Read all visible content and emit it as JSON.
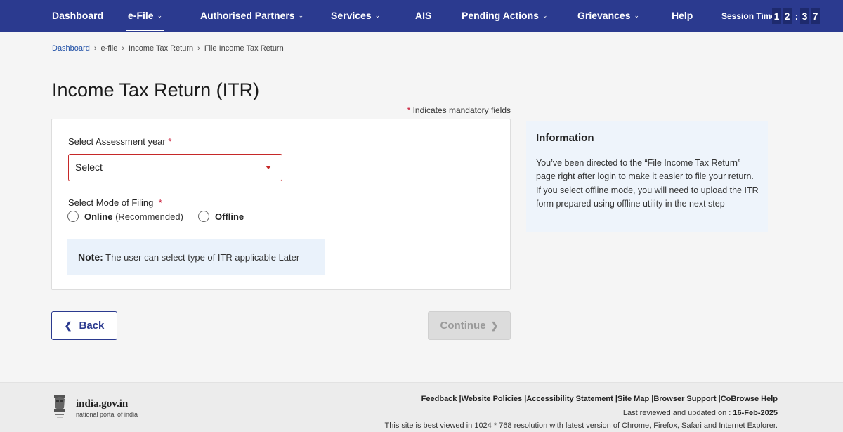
{
  "nav": {
    "items": [
      {
        "label": "Dashboard",
        "chevron": false
      },
      {
        "label": "e-File",
        "chevron": true,
        "active": true
      },
      {
        "label": "Authorised Partners",
        "chevron": true
      },
      {
        "label": "Services",
        "chevron": true
      },
      {
        "label": "AIS",
        "chevron": false
      },
      {
        "label": "Pending Actions",
        "chevron": true
      },
      {
        "label": "Grievances",
        "chevron": true
      },
      {
        "label": "Help",
        "chevron": false
      }
    ],
    "session_label": "Session Time",
    "session_digits": [
      "1",
      "2",
      ":",
      "3",
      "7"
    ]
  },
  "breadcrumb": [
    "Dashboard",
    "e-file",
    "Income Tax Return",
    "File Income Tax Return"
  ],
  "page": {
    "title": "Income Tax Return (ITR)",
    "mandatory_star": "*",
    "mandatory_text": "Indicates mandatory fields"
  },
  "form": {
    "assessment_label": "Select Assessment year",
    "assessment_value": "Select",
    "mode_label": "Select Mode of Filing",
    "online_label": "Online",
    "online_hint": "(Recommended)",
    "offline_label": "Offline",
    "note_bold": "Note:",
    "note_text": "The user can select type of ITR applicable Later"
  },
  "info": {
    "title": "Information",
    "line1": "You’ve been directed to the “File Income Tax Return” page right after login to make it easier to file your return.",
    "line2": "If you select offline mode, you will need to upload the ITR form prepared using offline utility in the next step"
  },
  "buttons": {
    "back": "Back",
    "continue": "Continue"
  },
  "footer": {
    "brand": "india.gov.in",
    "sub": "national portal of india",
    "links": [
      "Feedback",
      "Website Policies",
      "Accessibility Statement",
      "Site Map",
      "Browser Support",
      "CoBrowse Help"
    ],
    "updated_label": "Last reviewed and updated on :",
    "updated_date": "16-Feb-2025",
    "best_viewed": "This site is best viewed in 1024 * 768 resolution with latest version of Chrome, Firefox, Safari and Internet Explorer."
  }
}
